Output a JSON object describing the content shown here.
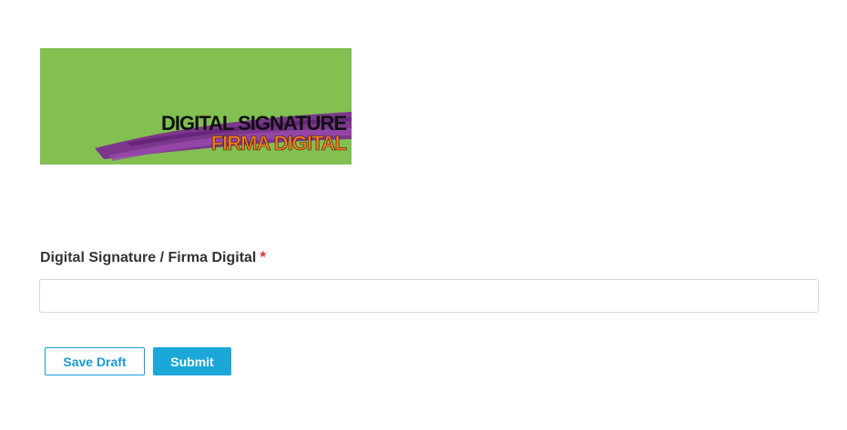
{
  "banner": {
    "line1": "DIGITAL SIGNATURE",
    "line2": "FIRMA DIGITAL",
    "background_color": "#82c052",
    "stroke_color": "#7b2f8f",
    "line2_color": "#f07c1f"
  },
  "form": {
    "field_label": "Digital Signature / Firma Digital",
    "required_marker": "*",
    "input_value": "",
    "input_placeholder": ""
  },
  "actions": {
    "save_draft_label": "Save Draft",
    "submit_label": "Submit"
  },
  "colors": {
    "accent": "#1ba8d8",
    "required": "#e0322f"
  }
}
